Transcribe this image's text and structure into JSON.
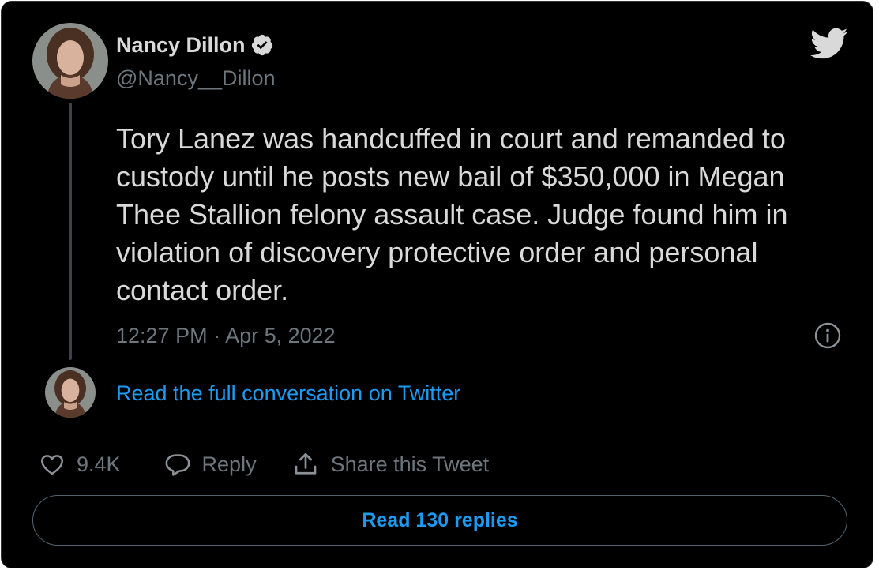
{
  "author": {
    "display_name": "Nancy Dillon",
    "handle": "@Nancy__Dillon",
    "verified": true
  },
  "tweet": {
    "text": "Tory Lanez was handcuffed in court and remanded to custody until he posts new bail of $350,000 in Megan Thee Stallion felony assault case. Judge found him in violation of discovery protective order and personal contact order.",
    "timestamp": "12:27 PM · Apr 5, 2022"
  },
  "conversation_link": "Read the full conversation on Twitter",
  "actions": {
    "like_count": "9.4K",
    "reply_label": "Reply",
    "share_label": "Share this Tweet"
  },
  "read_replies_label": "Read 130 replies",
  "icons": {
    "brand": "twitter-bird-icon",
    "verified": "verified-badge-icon",
    "info": "info-icon",
    "like": "heart-icon",
    "reply": "speech-bubble-icon",
    "share": "share-upload-icon"
  },
  "colors": {
    "background": "#000000",
    "text": "#d9d9d9",
    "secondary_text": "#6e767d",
    "link": "#1d9bf0",
    "border": "#2f3336"
  }
}
